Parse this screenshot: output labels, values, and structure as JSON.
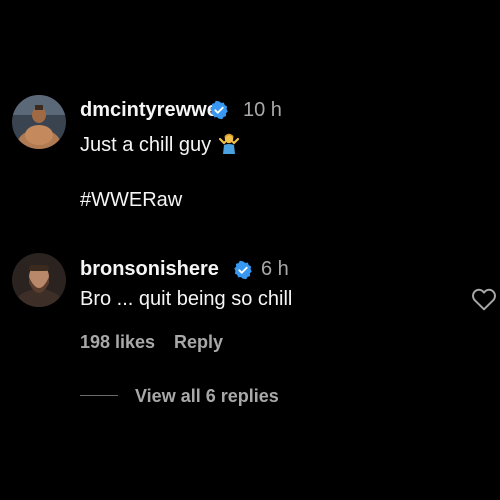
{
  "comments": [
    {
      "username": "dmcintyrewwe",
      "verified": true,
      "time": "10 h",
      "text": "Just a chill guy",
      "emoji": "person-shrugging-emoji",
      "hashtag": "#WWERaw",
      "avatar": "wrestler-avatar-shirtless"
    },
    {
      "username": "bronsonishere",
      "verified": true,
      "time": "6 h",
      "text": "Bro ... quit being so chill",
      "likes": "198 likes",
      "reply": "Reply",
      "avatar": "wrestler-avatar-bearded"
    }
  ],
  "replies": {
    "view_label": "View all 6 replies"
  },
  "icons": {
    "verified": "verified-badge-icon",
    "like": "heart-icon"
  },
  "colors": {
    "background": "#000000",
    "text": "#f5f5f5",
    "muted": "#a8a8a8",
    "verified": "#3897f0"
  }
}
